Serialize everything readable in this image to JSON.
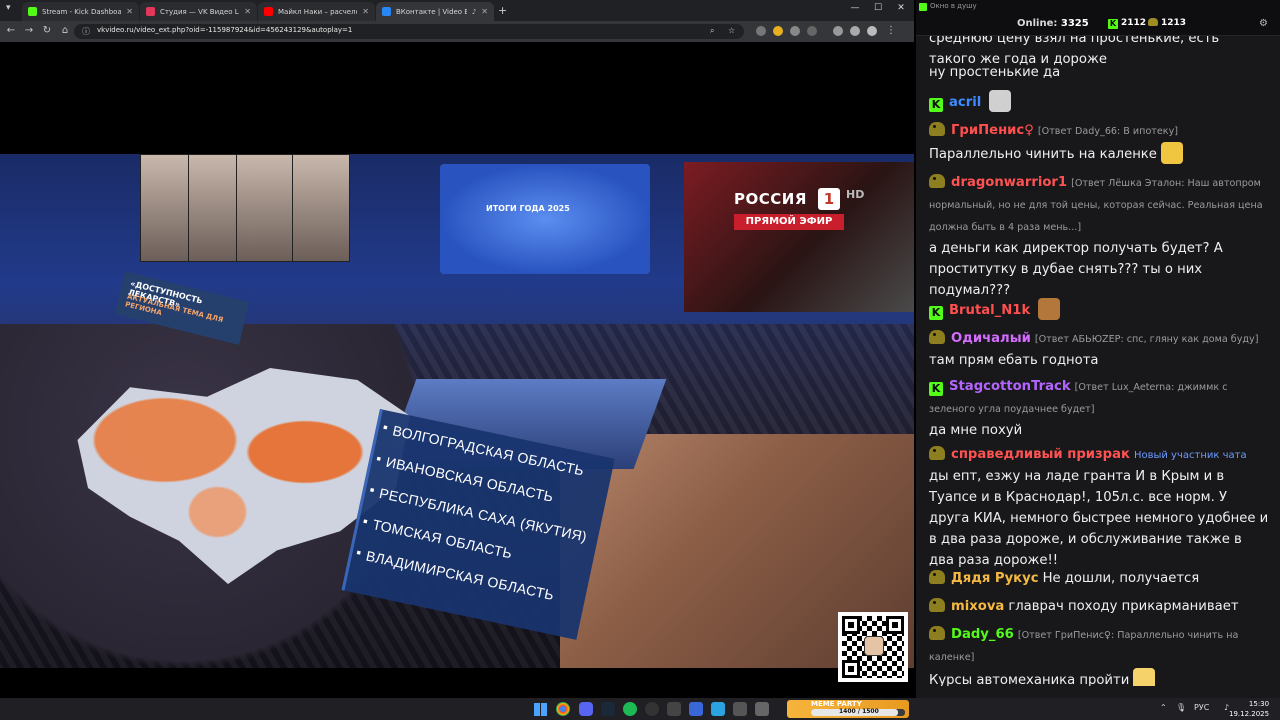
{
  "browser": {
    "tabs": [
      {
        "title": "Stream - Kick Dashboard",
        "color": "#53fc18",
        "active": false
      },
      {
        "title": "Студия — VK Видео Live",
        "color": "#e5375b",
        "active": false
      },
      {
        "title": "Майкл Наки – расчеловечива...",
        "color": "#ff0000",
        "active": false
      },
      {
        "title": "ВКонтакте | Video Ext",
        "color": "#2787f5",
        "active": true
      }
    ],
    "url": "vkvideo.ru/video_ext.php?oid=-115987924&id=456243129&autoplay=1"
  },
  "video": {
    "map_screen_label": "ИТОГИ ГОДА 2025",
    "channel": "РОССИЯ",
    "channel_number": "1",
    "channel_hd": "HD",
    "live_label": "ПРЯМОЙ ЭФИР",
    "banner_title": "«ДОСТУПНОСТЬ ЛЕКАРСТВ»",
    "banner_subtitle": "АКТУАЛЬНАЯ ТЕМА ДЛЯ РЕГИОНА",
    "regions": [
      "ВОЛГОГРАДСКАЯ ОБЛАСТЬ",
      "ИВАНОВСКАЯ ОБЛАСТЬ",
      "РЕСПУБЛИКА САХА (ЯКУТИЯ)",
      "ТОМСКАЯ ОБЛАСТЬ",
      "ВЛАДИМИРСКАЯ ОБЛАСТЬ"
    ]
  },
  "chat": {
    "window_title": "Окно в душу",
    "online_label": "Online:",
    "online_count": "3325",
    "stat_k": "2112",
    "stat_bag": "1213",
    "messages": [
      {
        "badge": "k",
        "user": "",
        "color": "#53fc18",
        "reply": "",
        "text": "среднюю цену взял на простенькие, есть такого же года и дороже"
      },
      {
        "badge": "",
        "user": "",
        "color": "#efeff1",
        "reply": "",
        "text": "ну простенькие да"
      },
      {
        "badge": "k",
        "user": "acril",
        "color": "#3d8bff",
        "reply": "",
        "text": ""
      },
      {
        "badge": "pig",
        "user": "ГриПенис♀",
        "color": "#ff4f4f",
        "reply": "[Ответ Dady_66: В ипотеку]",
        "text": "Параллельно чинить на каленке"
      },
      {
        "badge": "pig",
        "user": "dragonwarrior1",
        "color": "#ff5252",
        "reply": "[Ответ Лёшка Эталон: Наш автопром нормальный, но не для той цены, которая сейчас. Реальная цена должна быть в 4 раза мень...]",
        "text": "а деньги как директор получать будет? А проститутку в дубае снять??? ты о них подумал???"
      },
      {
        "badge": "k",
        "user": "Brutal_N1k",
        "color": "#ff4f4f",
        "reply": "",
        "text": ""
      },
      {
        "badge": "pig",
        "user": "Одичалый",
        "color": "#d46cff",
        "reply": "[Ответ АБЬЮZEP: спс, гляну как дома буду]",
        "text": "там прям ебать годнота"
      },
      {
        "badge": "k",
        "user": "StagcottonTrack",
        "color": "#b565ff",
        "reply": "[Ответ Lux_Aeterna: джиммк с зеленого угла поудачнее будет]",
        "text": "да мне похуй"
      },
      {
        "badge": "pig",
        "user": "справедливый призрак",
        "color": "#ff5252",
        "reply": "Новый участник чата",
        "text": "ды епт, езжу на ладе гранта И в Крым и в Туапсе и в Краснодар!, 105л.с. все норм. У друга КИА, немного быстрее немного удобнее и в два раза дороже, и обслуживание также в два раза дороже!!"
      },
      {
        "badge": "pig",
        "user": "Дядя Рукус",
        "color": "#f5b942",
        "reply": "",
        "text": "Не дошли, получается"
      },
      {
        "badge": "pig",
        "user": "mixova",
        "color": "#f5b942",
        "reply": "",
        "text": "главрач походу прикарманивает"
      },
      {
        "badge": "pig",
        "user": "Dady_66",
        "color": "#53fc18",
        "reply": "[Ответ ГриПенис♀: Параллельно чинить на каленке]",
        "text": "Курсы автомеханика пройти"
      }
    ]
  },
  "taskbar": {
    "widget_label": "MEME PARTY",
    "widget_value": "1400 / 1500",
    "widget_progress": 0.93,
    "lang": "РУС",
    "time": "15:30",
    "date": "19.12.2025"
  }
}
